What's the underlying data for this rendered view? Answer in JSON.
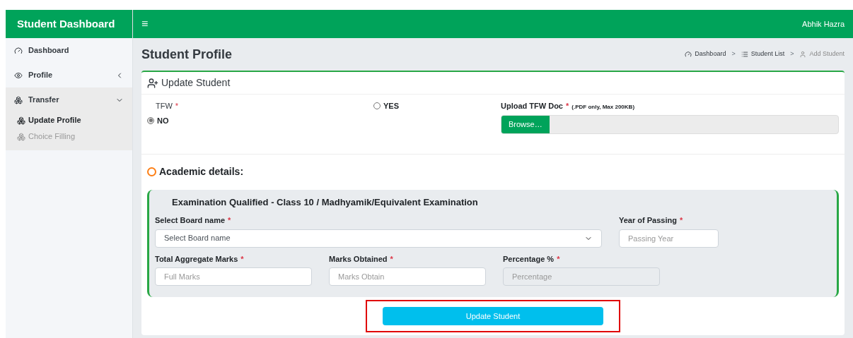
{
  "header": {
    "brand": "Student Dashboard",
    "menu_glyph": "≡",
    "user": "Abhik Hazra"
  },
  "sidebar": {
    "items": [
      {
        "label": "Dashboard",
        "selected": false
      },
      {
        "label": "Profile",
        "selected": false,
        "expanded": false
      },
      {
        "label": "Transfer",
        "selected": false,
        "expanded": true,
        "children": [
          {
            "label": "Update Profile",
            "selected": true
          },
          {
            "label": "Choice Filling",
            "selected": false
          }
        ]
      }
    ]
  },
  "page": {
    "title": "Student Profile",
    "breadcrumb": [
      {
        "label": "Dashboard",
        "current": false
      },
      {
        "separator": ">",
        "label": "Student List",
        "current": false
      },
      {
        "separator": ">",
        "label": "Add Student",
        "current": true
      }
    ]
  },
  "card": {
    "title": "Update Student",
    "tfw": {
      "label": "TFW",
      "required_mark": "*",
      "options": [
        {
          "label": "YES",
          "selected": false
        },
        {
          "label": "NO",
          "selected": true
        }
      ]
    },
    "upload": {
      "label": "Upload TFW Doc",
      "required_mark": "*",
      "hint": "(.PDF only, Max 200KB)",
      "button": "Browse…"
    },
    "section_title": "Academic details:",
    "exam": {
      "title": "Examination Qualified - Class 10 / Madhyamik/Equivalent Examination",
      "fields": [
        {
          "kind": "select",
          "label": "Select Board name",
          "required_mark": "*",
          "placeholder": "Select Board name",
          "disabled": false
        },
        {
          "kind": "input",
          "label": "Year of Passing",
          "required_mark": "*",
          "placeholder": "Passing Year",
          "disabled": false
        },
        {
          "kind": "input",
          "label": "Total Aggregate Marks",
          "required_mark": "*",
          "placeholder": "Full Marks",
          "disabled": false
        },
        {
          "kind": "input",
          "label": "Marks Obtained",
          "required_mark": "*",
          "placeholder": "Marks Obtain",
          "disabled": false
        },
        {
          "kind": "input",
          "label": "Percentage %",
          "required_mark": "*",
          "placeholder": "Percentage",
          "disabled": true
        }
      ]
    },
    "submit": {
      "label": "Update Student",
      "highlighted": true
    }
  }
}
